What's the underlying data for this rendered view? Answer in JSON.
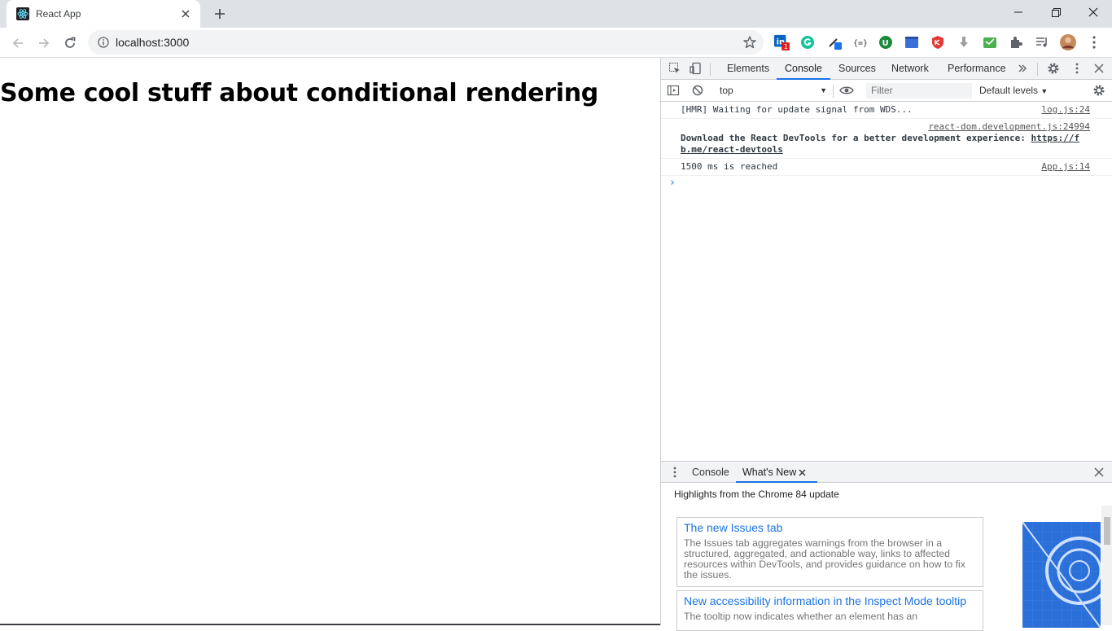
{
  "browser": {
    "tab_title": "React App",
    "url": "localhost:3000",
    "extension_badge": "1"
  },
  "page": {
    "heading": "Some cool stuff about conditional rendering"
  },
  "devtools": {
    "tabs": [
      "Elements",
      "Console",
      "Sources",
      "Network",
      "Performance"
    ],
    "active_tab": "Console",
    "context": "top",
    "filter_placeholder": "Filter",
    "levels": "Default levels",
    "messages": [
      {
        "text": "[HMR] Waiting for update signal from WDS...",
        "source": "log.js:24"
      },
      {
        "source": "react-dom.development.js:24994",
        "text": "Download the React DevTools for a better development experience: ",
        "link": "https://fb.me/react-devtools"
      },
      {
        "text": "1500 ms is reached",
        "source": "App.js:14"
      }
    ],
    "drawer": {
      "tabs": [
        "Console",
        "What's New"
      ],
      "active_tab": "What's New",
      "highlights": "Highlights from the Chrome 84 update",
      "cards": [
        {
          "title": "The new Issues tab",
          "body": "The Issues tab aggregates warnings from the browser in a structured, aggregated, and actionable way, links to affected resources within DevTools, and provides guidance on how to fix the issues."
        },
        {
          "title": "New accessibility information in the Inspect Mode tooltip",
          "body": "The tooltip now indicates whether an element has an"
        }
      ]
    }
  },
  "colors": {
    "accent": "#1a73e8",
    "tabstrip": "#dee1e6",
    "promo": "#2b6fd8"
  }
}
